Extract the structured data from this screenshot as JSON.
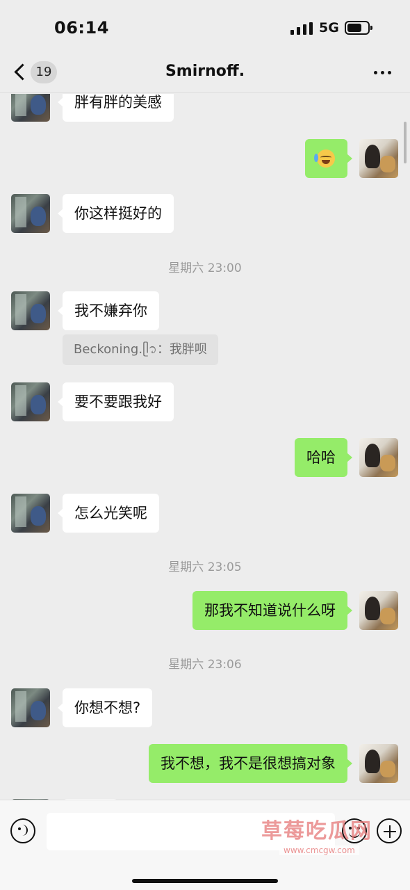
{
  "status_bar": {
    "time": "06:14",
    "network": "5G"
  },
  "nav": {
    "unread_count": "19",
    "title": "Smirnoff."
  },
  "messages": [
    {
      "side": "left",
      "text": "胖有胖的美感"
    },
    {
      "side": "right",
      "text": "",
      "emoji": "crying-laughing-emoji"
    },
    {
      "side": "left",
      "text": "你这样挺好的"
    },
    {
      "type": "time",
      "text": "星期六 23:00"
    },
    {
      "side": "left",
      "text": "我不嫌弃你"
    },
    {
      "type": "quote",
      "text": "Beckoning.👋：我胖呗"
    },
    {
      "side": "left",
      "text": "要不要跟我好"
    },
    {
      "side": "right",
      "text": "哈哈"
    },
    {
      "side": "left",
      "text": "怎么光笑呢"
    },
    {
      "type": "time",
      "text": "星期六 23:05"
    },
    {
      "side": "right",
      "text": "那我不知道说什么呀"
    },
    {
      "type": "time",
      "text": "星期六 23:06"
    },
    {
      "side": "left",
      "text": "你想不想?"
    },
    {
      "side": "right",
      "text": "我不想，我不是很想搞对象"
    }
  ],
  "quote_text": "Beckoning.ᥫ᭡：我胖呗",
  "input": {
    "value": ""
  },
  "watermark": {
    "main": "草莓吃瓜网",
    "sub": "www.cmcgw.com"
  },
  "colors": {
    "background": "#ededed",
    "bubble_self": "#95ec69",
    "bubble_other": "#ffffff"
  },
  "icons": {
    "back": "chevron-left-icon",
    "more": "ellipsis-icon",
    "voice": "voice-icon",
    "emoji": "emoji-icon",
    "add": "plus-icon"
  }
}
